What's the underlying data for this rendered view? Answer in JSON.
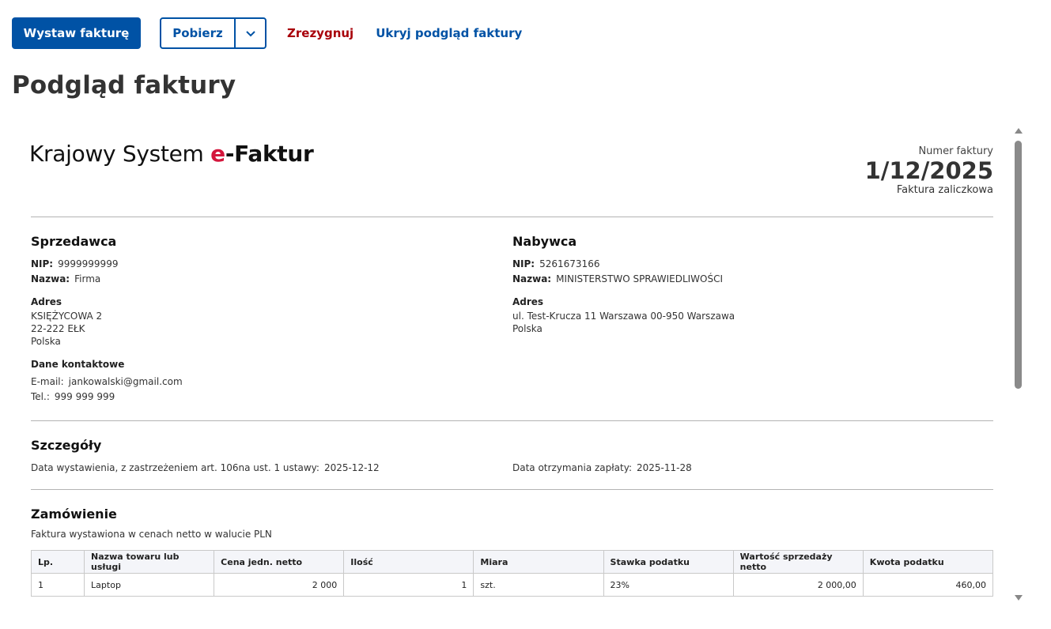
{
  "toolbar": {
    "issue_label": "Wystaw fakturę",
    "download_label": "Pobierz",
    "cancel_label": "Zrezygnuj",
    "hide_preview_label": "Ukryj podgląd faktury"
  },
  "page": {
    "title": "Podgląd faktury"
  },
  "invoice": {
    "brand_prefix": "Krajowy System ",
    "brand_e": "e",
    "brand_suffix": "-Faktur",
    "number_label": "Numer faktury",
    "number": "1/12/2025",
    "type": "Faktura zaliczkowa",
    "seller": {
      "title": "Sprzedawca",
      "nip_label": "NIP:",
      "nip": "9999999999",
      "name_label": "Nazwa:",
      "name": "Firma",
      "address_label": "Adres",
      "address_line1": "KSIĘŻYCOWA 2",
      "address_line2": "22-222 EŁK",
      "address_line3": "Polska",
      "contact_label": "Dane kontaktowe",
      "email_label": "E-mail:",
      "email": "jankowalski@gmail.com",
      "phone_label": "Tel.:",
      "phone": "999 999 999"
    },
    "buyer": {
      "title": "Nabywca",
      "nip_label": "NIP:",
      "nip": "5261673166",
      "name_label": "Nazwa:",
      "name": "MINISTERSTWO SPRAWIEDLIWOŚCI",
      "address_label": "Adres",
      "address_line1": "ul. Test-Krucza 11 Warszawa 00-950 Warszawa",
      "address_line2": "Polska"
    },
    "details": {
      "title": "Szczegóły",
      "issue_date_label": "Data wystawienia, z zastrzeżeniem art. 106na ust. 1 ustawy:",
      "issue_date": "2025-12-12",
      "payment_date_label": "Data otrzymania zapłaty:",
      "payment_date": "2025-11-28"
    },
    "order": {
      "title": "Zamówienie",
      "note": "Faktura wystawiona w cenach netto w walucie PLN",
      "columns": [
        "Lp.",
        "Nazwa towaru lub usługi",
        "Cena jedn. netto",
        "Ilość",
        "Miara",
        "Stawka podatku",
        "Wartość sprzedaży netto",
        "Kwota podatku"
      ],
      "rows": [
        [
          "1",
          "Laptop",
          "2 000",
          "1",
          "szt.",
          "23%",
          "2 000,00",
          "460,00"
        ]
      ]
    }
  }
}
